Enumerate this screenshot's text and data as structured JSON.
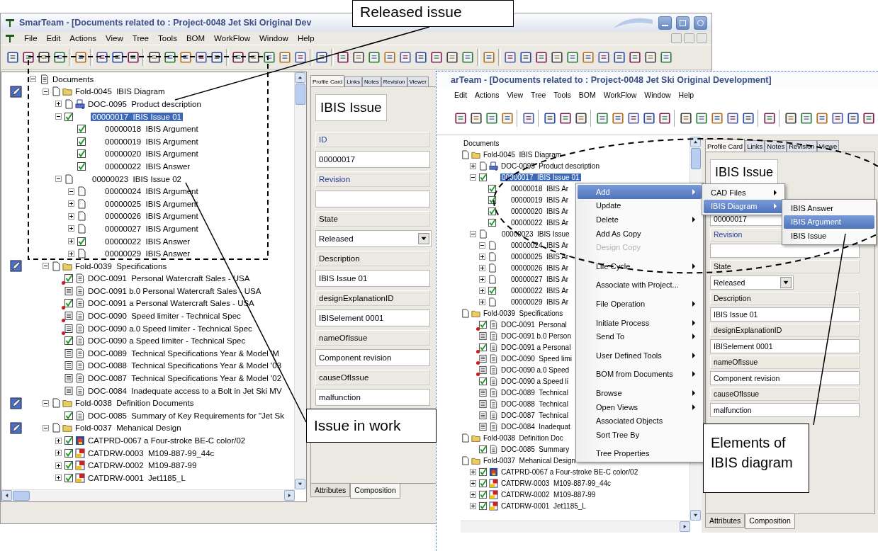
{
  "main_window": {
    "title": "SmarTeam - [Documents related to : Project-0048 Jet Ski Original Dev",
    "menu": [
      "File",
      "Edit",
      "Actions",
      "View",
      "Tree",
      "Tools",
      "BOM",
      "WorkFlow",
      "Window",
      "Help"
    ],
    "tree": [
      {
        "label": "Documents",
        "kind": "root",
        "expanded": true,
        "selected": false,
        "children": [
          {
            "label": "Fold-0045  IBIS Diagram",
            "checked": false,
            "kind": "folder",
            "tagged": true,
            "expanded": true,
            "selected": false,
            "children": [
              {
                "label": "DOC-0095  Product description",
                "checked": false,
                "kind": "print-doc",
                "expanded": false,
                "selected": false
              },
              {
                "label": "00000017  IBIS Issue 01",
                "checked": true,
                "kind": "none",
                "expanded": true,
                "selected": true,
                "children": [
                  {
                    "label": "00000018  IBIS Argument",
                    "checked": true,
                    "kind": "none",
                    "selected": false
                  },
                  {
                    "label": "00000019  IBIS Argument",
                    "checked": true,
                    "kind": "none",
                    "selected": false
                  },
                  {
                    "label": "00000020  IBIS Argument",
                    "checked": true,
                    "kind": "none",
                    "selected": false
                  },
                  {
                    "label": "00000022  IBIS Answer",
                    "checked": true,
                    "kind": "none",
                    "selected": false
                  }
                ]
              },
              {
                "label": "00000023  IBIS Issue 02",
                "checked": false,
                "kind": "none",
                "expanded": true,
                "selected": false,
                "children": [
                  {
                    "label": "00000024  IBIS Argument",
                    "checked": false,
                    "kind": "none",
                    "expanded": true,
                    "selected": false
                  },
                  {
                    "label": "00000025  IBIS Argument",
                    "checked": false,
                    "kind": "none",
                    "expanded": false,
                    "selected": false
                  },
                  {
                    "label": "00000026  IBIS Argument",
                    "checked": false,
                    "kind": "none",
                    "expanded": false,
                    "selected": false
                  },
                  {
                    "label": "00000027  IBIS Argument",
                    "checked": false,
                    "kind": "none",
                    "expanded": false,
                    "selected": false
                  },
                  {
                    "label": "00000022  IBIS Answer",
                    "checked": true,
                    "kind": "none",
                    "expanded": false,
                    "selected": false
                  },
                  {
                    "label": "00000029  IBIS Answer",
                    "checked": false,
                    "kind": "none",
                    "expanded": false,
                    "selected": false
                  }
                ]
              }
            ]
          },
          {
            "label": "Fold-0039  Specifications",
            "checked": false,
            "kind": "folder",
            "tagged": true,
            "expanded": true,
            "selected": false,
            "children": [
              {
                "label": "DOC-0091  Personal Watercraft Sales - USA",
                "checked": true,
                "in_work": false,
                "kind": "document",
                "locked": true,
                "selected": false
              },
              {
                "label": "DOC-0091 b.0 Personal Watercraft Sales - USA",
                "checked": false,
                "in_work": true,
                "kind": "document",
                "locked": false,
                "selected": false
              },
              {
                "label": "DOC-0091 a Personal Watercraft Sales - USA",
                "checked": true,
                "in_work": false,
                "kind": "document",
                "locked": true,
                "selected": false
              },
              {
                "label": "DOC-0090  Speed limiter - Technical Spec",
                "checked": false,
                "in_work": true,
                "kind": "document",
                "locked": true,
                "selected": false
              },
              {
                "label": "DOC-0090 a.0 Speed limiter - Technical Spec",
                "checked": false,
                "in_work": true,
                "kind": "document",
                "locked": true,
                "selected": false
              },
              {
                "label": "DOC-0090 a Speed limiter - Technical Spec",
                "checked": true,
                "in_work": false,
                "kind": "document",
                "locked": false,
                "selected": false
              },
              {
                "label": "DOC-0089  Technical Specifications Year & Model 'M",
                "checked": false,
                "in_work": true,
                "kind": "document",
                "locked": false,
                "selected": false
              },
              {
                "label": "DOC-0088  Technical Specifications Year & Model '03",
                "checked": false,
                "in_work": true,
                "kind": "document",
                "locked": false,
                "selected": false
              },
              {
                "label": "DOC-0087  Technical Specifications Year & Model '02",
                "checked": false,
                "in_work": true,
                "kind": "document",
                "locked": false,
                "selected": false
              },
              {
                "label": "DOC-0084  Inadequate access to a Bolt in Jet Ski MV",
                "checked": false,
                "in_work": true,
                "kind": "document",
                "locked": false,
                "selected": false
              }
            ]
          },
          {
            "label": "Fold-0038  Definition Documents",
            "checked": false,
            "kind": "folder",
            "tagged": true,
            "expanded": true,
            "selected": false,
            "children": [
              {
                "label": "DOC-0085  Summary of Key Requirements for \"Jet Sk",
                "checked": true,
                "kind": "document",
                "selected": false
              }
            ]
          },
          {
            "label": "Fold-0037  Mehanical Design",
            "checked": false,
            "kind": "folder",
            "tagged": true,
            "expanded": true,
            "selected": false,
            "children": [
              {
                "label": "CATPRD-0067 a Four-stroke BE-C color/02",
                "checked": true,
                "kind": "product",
                "expanded": false,
                "selected": false
              },
              {
                "label": "CATDRW-0003  M109-887-99_44c",
                "checked": true,
                "kind": "drawing",
                "expanded": false,
                "selected": false
              },
              {
                "label": "CATDRW-0002  M109-887-99",
                "checked": true,
                "kind": "drawing",
                "expanded": false,
                "selected": false
              },
              {
                "label": "CATDRW-0001  Jet1185_L",
                "checked": true,
                "kind": "drawing",
                "expanded": false,
                "selected": false
              }
            ]
          }
        ]
      }
    ],
    "profile_card": {
      "tabs": [
        {
          "label": "Profile Card",
          "selected": true
        },
        {
          "label": "Links",
          "selected": false
        },
        {
          "label": "Notes",
          "selected": false
        },
        {
          "label": "Revision",
          "selected": false
        },
        {
          "label": "Viewer",
          "selected": false
        }
      ],
      "title": "IBIS Issue",
      "fields": [
        {
          "label": "ID",
          "linked": true,
          "kind": "input",
          "value": "00000017"
        },
        {
          "label": "Revision",
          "linked": true,
          "kind": "input"
        },
        {
          "label": "State",
          "linked": false,
          "kind": "dropdown",
          "value": "Released"
        },
        {
          "label": "Description",
          "linked": false,
          "kind": "input",
          "value": "IBIS Issue 01"
        },
        {
          "label": "designExplanationID",
          "linked": false,
          "kind": "input",
          "value": "IBISelement 0001"
        },
        {
          "label": "nameOfIssue",
          "linked": false,
          "kind": "input",
          "value": "Component revision"
        },
        {
          "label": "causeOfIssue",
          "linked": false,
          "kind": "input",
          "value": "malfunction"
        }
      ],
      "bottom_tabs": [
        {
          "label": "Attributes",
          "selected": false
        },
        {
          "label": "Composition",
          "selected": true
        }
      ]
    }
  },
  "second_window": {
    "title": "arTeam - [Documents related to : Project-0048 Jet Ski Original Development]",
    "menu": [
      "Edit",
      "Actions",
      "View",
      "Tree",
      "Tools",
      "BOM",
      "WorkFlow",
      "Window",
      "Help"
    ],
    "tree": [
      {
        "label": "Documents",
        "selected": false,
        "children": [
          {
            "label": "Fold-0045  IBIS Diagram",
            "checked": false,
            "kind": "folder",
            "selected": false,
            "children": [
              {
                "label": "DOC-0095  Product description",
                "checked": false,
                "kind": "print-doc",
                "expanded": false,
                "selected": false
              },
              {
                "label": "00000017  IBIS Issue 01",
                "checked": true,
                "kind": "none",
                "expanded": true,
                "selected": true,
                "children": [
                  {
                    "label": "00000018  IBIS Ar",
                    "checked": true,
                    "kind": "none",
                    "selected": false
                  },
                  {
                    "label": "00000019  IBIS Ar",
                    "checked": true,
                    "kind": "none",
                    "selected": false
                  },
                  {
                    "label": "00000020  IBIS Ar",
                    "checked": true,
                    "kind": "none",
                    "selected": false
                  },
                  {
                    "label": "00000022  IBIS Ar",
                    "checked": true,
                    "kind": "none",
                    "selected": false
                  }
                ]
              },
              {
                "label": "00000023  IBIS Issue",
                "checked": false,
                "kind": "none",
                "expanded": true,
                "selected": false,
                "children": [
                  {
                    "label": "00000024  IBIS Ar",
                    "checked": false,
                    "kind": "none",
                    "expanded": true,
                    "selected": false
                  },
                  {
                    "label": "00000025  IBIS Ar",
                    "checked": false,
                    "kind": "none",
                    "expanded": false,
                    "selected": false
                  },
                  {
                    "label": "00000026  IBIS Ar",
                    "checked": false,
                    "kind": "none",
                    "expanded": false,
                    "selected": false
                  },
                  {
                    "label": "00000027  IBIS Ar",
                    "checked": false,
                    "kind": "none",
                    "expanded": false,
                    "selected": false
                  },
                  {
                    "label": "00000022  IBIS Ar",
                    "checked": true,
                    "kind": "none",
                    "expanded": false,
                    "selected": false
                  },
                  {
                    "label": "00000029  IBIS Ar",
                    "checked": false,
                    "kind": "none",
                    "expanded": false,
                    "selected": false
                  }
                ]
              }
            ]
          },
          {
            "label": "Fold-0039  Specifications",
            "checked": false,
            "kind": "folder",
            "selected": false,
            "children": [
              {
                "label": "DOC-0091  Personal",
                "checked": true,
                "in_work": false,
                "kind": "document",
                "locked": true,
                "selected": false
              },
              {
                "label": "DOC-0091 b.0 Person",
                "checked": false,
                "in_work": true,
                "kind": "document",
                "locked": false,
                "selected": false
              },
              {
                "label": "DOC-0091 a Personal",
                "checked": true,
                "in_work": false,
                "kind": "document",
                "locked": true,
                "selected": false
              },
              {
                "label": "DOC-0090  Speed limi",
                "checked": false,
                "in_work": true,
                "kind": "document",
                "locked": true,
                "selected": false
              },
              {
                "label": "DOC-0090 a.0 Speed",
                "checked": false,
                "in_work": true,
                "kind": "document",
                "locked": true,
                "selected": false
              },
              {
                "label": "DOC-0090 a Speed li",
                "checked": true,
                "in_work": false,
                "kind": "document",
                "locked": false,
                "selected": false
              },
              {
                "label": "DOC-0089  Technical",
                "checked": false,
                "in_work": true,
                "kind": "document",
                "locked": false,
                "selected": false
              },
              {
                "label": "DOC-0088  Technical",
                "checked": false,
                "in_work": true,
                "kind": "document",
                "locked": false,
                "selected": false
              },
              {
                "label": "DOC-0087  Technical",
                "checked": false,
                "in_work": true,
                "kind": "document",
                "locked": false,
                "selected": false
              },
              {
                "label": "DOC-0084  Inadequat",
                "checked": false,
                "in_work": true,
                "kind": "document",
                "locked": false,
                "selected": false
              }
            ]
          },
          {
            "label": "Fold-0038  Definition Doc",
            "checked": false,
            "kind": "folder",
            "selected": false,
            "children": [
              {
                "label": "DOC-0085  Summary",
                "checked": true,
                "kind": "document",
                "selected": false
              }
            ]
          },
          {
            "label": "Fold-0037  Mehanical Design",
            "checked": false,
            "kind": "folder",
            "selected": false,
            "children": [
              {
                "label": "CATPRD-0067 a Four-stroke BE-C color/02",
                "checked": true,
                "kind": "product",
                "expanded": false,
                "selected": false
              },
              {
                "label": "CATDRW-0003  M109-887-99_44c",
                "checked": true,
                "kind": "drawing",
                "expanded": false,
                "selected": false
              },
              {
                "label": "CATDRW-0002  M109-887-99",
                "checked": true,
                "kind": "drawing",
                "expanded": false,
                "selected": false
              },
              {
                "label": "CATDRW-0001  Jet1185_L",
                "checked": true,
                "kind": "drawing",
                "expanded": false,
                "selected": false
              }
            ]
          }
        ]
      }
    ],
    "profile_card": {
      "tabs": [
        {
          "label": "Profile Card",
          "selected": true
        },
        {
          "label": "Links",
          "selected": false
        },
        {
          "label": "Notes",
          "selected": false
        },
        {
          "label": "Revision",
          "selected": false
        },
        {
          "label": "Viewe",
          "selected": false
        }
      ],
      "title": "IBIS Issue",
      "fields": [
        {
          "kind": "input",
          "value": "00000017"
        },
        {
          "label": "Revision",
          "linked": true,
          "kind": "input"
        },
        {
          "label": "State",
          "linked": false,
          "kind": "dropdown",
          "value": "Released"
        },
        {
          "label": "Description",
          "linked": false,
          "kind": "input",
          "value": "IBIS Issue 01"
        },
        {
          "label": "designExplanationID",
          "linked": false,
          "kind": "input",
          "value": "IBISelement 0001"
        },
        {
          "label": "nameOfIssue",
          "linked": false,
          "kind": "input",
          "value": "Component revision"
        },
        {
          "label": "causeOfIssue",
          "linked": false,
          "kind": "input",
          "value": "malfunction"
        }
      ],
      "bottom_tabs": [
        {
          "label": "Attributes",
          "selected": false
        },
        {
          "label": "Composition",
          "selected": true
        }
      ]
    },
    "context_menu": [
      {
        "label": "Add",
        "submenu": true,
        "disabled": false,
        "selected": true,
        "gap_before": false
      },
      {
        "label": "Update",
        "submenu": false,
        "disabled": false,
        "selected": false,
        "gap_before": false
      },
      {
        "label": "Delete",
        "submenu": true,
        "disabled": false,
        "selected": false,
        "gap_before": false
      },
      {
        "label": "Add As Copy",
        "submenu": false,
        "disabled": false,
        "selected": false,
        "gap_before": false
      },
      {
        "label": "Design Copy",
        "submenu": false,
        "disabled": true,
        "selected": false,
        "gap_before": false
      },
      {
        "label": "Life Cycle",
        "submenu": true,
        "disabled": false,
        "selected": false,
        "gap_before": true
      },
      {
        "label": "Associate with Project...",
        "submenu": false,
        "disabled": false,
        "selected": false,
        "gap_before": true
      },
      {
        "label": "File Operation",
        "submenu": true,
        "disabled": false,
        "selected": false,
        "gap_before": true
      },
      {
        "label": "Initiate Process",
        "submenu": true,
        "disabled": false,
        "selected": false,
        "gap_before": true
      },
      {
        "label": "Send To",
        "submenu": true,
        "disabled": false,
        "selected": false,
        "gap_before": false
      },
      {
        "label": "User Defined Tools",
        "submenu": true,
        "disabled": false,
        "selected": false,
        "gap_before": true
      },
      {
        "label": "BOM from Documents",
        "submenu": true,
        "disabled": false,
        "selected": false,
        "gap_before": true
      },
      {
        "label": "Browse",
        "submenu": true,
        "disabled": false,
        "selected": false,
        "gap_before": true
      },
      {
        "label": "Open Views",
        "submenu": true,
        "disabled": false,
        "selected": false,
        "gap_before": false
      },
      {
        "label": "Associated Objects",
        "submenu": false,
        "disabled": false,
        "selected": false,
        "gap_before": false
      },
      {
        "label": "Sort Tree By",
        "submenu": false,
        "disabled": false,
        "selected": false,
        "gap_before": false
      },
      {
        "label": "Tree Properties",
        "submenu": false,
        "disabled": false,
        "selected": false,
        "gap_before": true
      }
    ],
    "add_submenu": [
      {
        "label": "CAD Files",
        "submenu": true,
        "selected": false
      },
      {
        "label": "IBIS Diagram",
        "submenu": true,
        "selected": true
      }
    ],
    "ibis_submenu": [
      {
        "label": "IBIS Answer",
        "selected": false
      },
      {
        "label": "IBIS Argument",
        "selected": true
      },
      {
        "label": "IBIS Issue",
        "selected": false
      }
    ]
  },
  "callouts": [
    {
      "text": "Released issue"
    },
    {
      "text": "Issue in work"
    },
    {
      "text": "Elements of IBIS diagram"
    }
  ]
}
